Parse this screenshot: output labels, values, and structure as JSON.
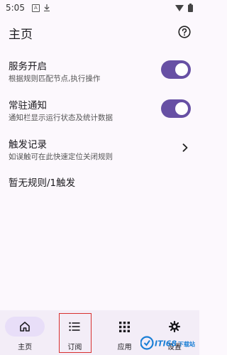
{
  "status_bar": {
    "time": "5:05",
    "left_icons": [
      "notification-a-icon",
      "download-icon"
    ],
    "right_icons": [
      "wifi-icon",
      "battery-icon"
    ]
  },
  "header": {
    "title": "主页",
    "help_icon": "help-circle-icon"
  },
  "settings": [
    {
      "title": "服务开启",
      "desc": "根据规则匹配节点,执行操作",
      "control": "switch",
      "on": true
    },
    {
      "title": "常驻通知",
      "desc": "通知栏显示运行状态及统计数据",
      "control": "switch",
      "on": true
    },
    {
      "title": "触发记录",
      "desc": "如误触可在此快速定位关闭规则",
      "control": "chevron"
    }
  ],
  "rules_summary": "暂无规则/1触发",
  "bottom_nav": [
    {
      "label": "主页",
      "icon": "home-icon",
      "active": true
    },
    {
      "label": "订阅",
      "icon": "list-icon",
      "active": false
    },
    {
      "label": "应用",
      "icon": "apps-grid-icon",
      "active": false
    },
    {
      "label": "设置",
      "icon": "settings-gear-icon",
      "active": false
    }
  ],
  "colors": {
    "accent": "#6750a4",
    "nav_background": "#f3edf7",
    "active_pill": "#e8def8",
    "highlight": "#d8302f"
  },
  "watermark": {
    "text": "ITI68下载站"
  }
}
